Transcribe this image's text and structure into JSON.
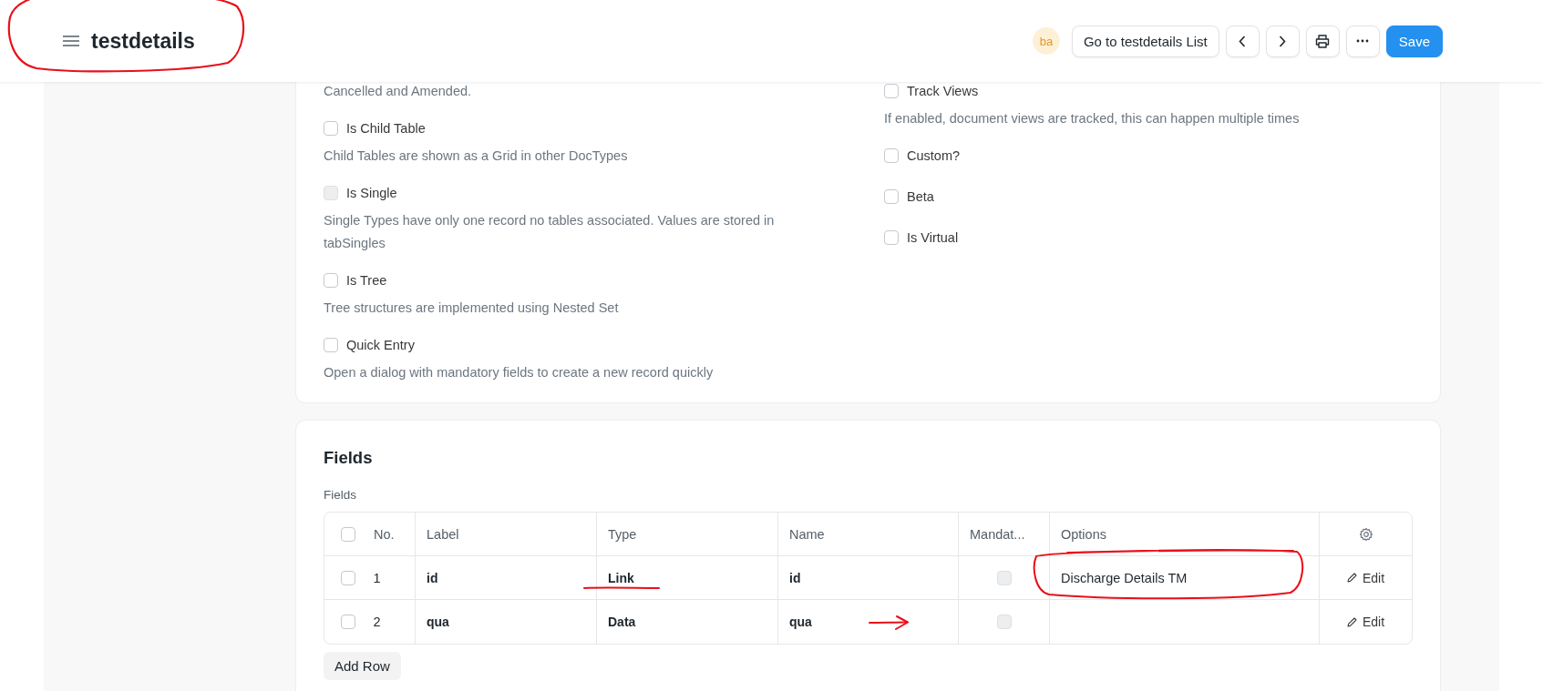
{
  "header": {
    "title": "testdetails",
    "title_circled": true,
    "avatar": "ba",
    "buttons": [
      {
        "kind": "text",
        "label": "Go to testdetails List"
      },
      {
        "kind": "prev"
      },
      {
        "kind": "next"
      },
      {
        "kind": "print"
      },
      {
        "kind": "more"
      },
      {
        "kind": "primary",
        "label": "Save"
      }
    ]
  },
  "settings": {
    "columns": [
      {
        "items": [
          {
            "kind": "description",
            "text": "Cancelled and Amended."
          },
          {
            "kind": "checkbox",
            "label": "Is Child Table",
            "checked": false,
            "disabled": false
          },
          {
            "kind": "description",
            "text": "Child Tables are shown as a Grid in other DocTypes"
          },
          {
            "kind": "checkbox",
            "label": "Is Single",
            "checked": false,
            "disabled": true
          },
          {
            "kind": "description",
            "text": "Single Types have only one record no tables associated. Values are stored in tabSingles"
          },
          {
            "kind": "checkbox",
            "label": "Is Tree",
            "checked": false,
            "disabled": false
          },
          {
            "kind": "description",
            "text": "Tree structures are implemented using Nested Set"
          },
          {
            "kind": "checkbox",
            "label": "Quick Entry",
            "checked": false,
            "disabled": false
          },
          {
            "kind": "description",
            "text": "Open a dialog with mandatory fields to create a new record quickly"
          }
        ]
      },
      {
        "items": [
          {
            "kind": "checkbox",
            "label": "Track Views",
            "checked": false,
            "disabled": false
          },
          {
            "kind": "description",
            "text": "If enabled, document views are tracked, this can happen multiple times"
          },
          {
            "kind": "checkbox",
            "label": "Custom?",
            "checked": false,
            "disabled": false
          },
          {
            "kind": "checkbox",
            "label": "Beta",
            "checked": false,
            "disabled": false
          },
          {
            "kind": "checkbox",
            "label": "Is Virtual",
            "checked": false,
            "disabled": false
          }
        ]
      }
    ]
  },
  "fields": {
    "title": "Fields",
    "table_label": "Fields",
    "table": {
      "all_selected": false,
      "columns": [
        "No.",
        "Label",
        "Type",
        "Name",
        "Mandat...",
        "Options"
      ],
      "rows": [
        {
          "selected": false,
          "no": "1",
          "label": "id",
          "type": "Link",
          "type_underlined": true,
          "name": "id",
          "name_arrow": false,
          "mandatory": false,
          "options": "Discharge Details TM",
          "options_circled": true,
          "edit": "Edit"
        },
        {
          "selected": false,
          "no": "2",
          "label": "qua",
          "type": "Data",
          "type_underlined": false,
          "name": "qua",
          "name_arrow": true,
          "mandatory": false,
          "options": "",
          "options_circled": false,
          "edit": "Edit"
        }
      ]
    },
    "add_row": "Add Row"
  }
}
